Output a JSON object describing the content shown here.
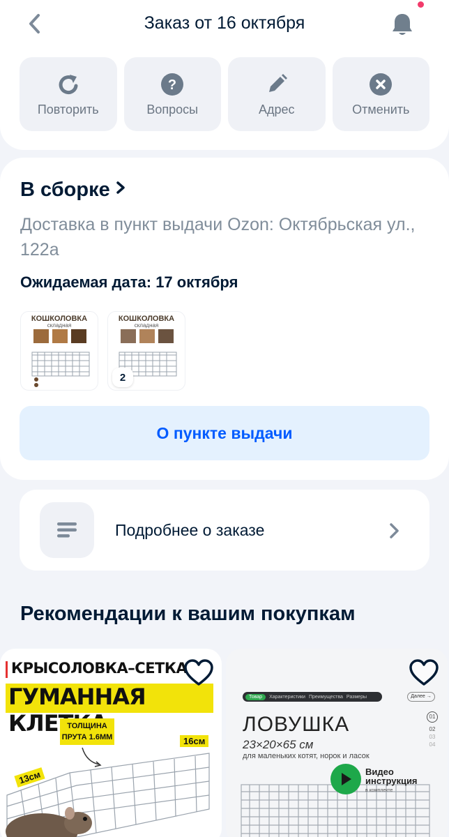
{
  "header": {
    "title": "Заказ от 16 октября",
    "back_icon": "chevron-left-icon",
    "bell_icon": "bell-icon"
  },
  "actions": [
    {
      "label": "Повторить",
      "icon": "repeat-icon"
    },
    {
      "label": "Вопросы",
      "icon": "question-icon"
    },
    {
      "label": "Адрес",
      "icon": "pencil-icon"
    },
    {
      "label": "Отменить",
      "icon": "close-circle-icon"
    }
  ],
  "status": {
    "title": "В сборке",
    "delivery": "Доставка в пункт выдачи Ozon: Октябрьская ул., 122а",
    "expected": "Ожидаемая дата: 17 октября"
  },
  "thumbnails": [
    {
      "name": "КОШКОЛОВКА",
      "sub": "складная"
    },
    {
      "name": "КОШКОЛОВКА",
      "sub": "складная",
      "count": "2"
    }
  ],
  "pickup_button": "О пункте выдачи",
  "more": {
    "label": "Подробнее о заказе"
  },
  "recommendations": {
    "title": "Рекомендации к вашим покупкам",
    "items": [
      {
        "line1": "КРЫСОЛОВКА–СЕТКА",
        "line2": "ГУМАННАЯ КЛЕТКА",
        "tag": "ТОЛЩИНА ПРУТА 1.6ММ",
        "dim_a": "16см",
        "dim_b": "13см"
      },
      {
        "nav": [
          "Товар",
          "Характеристики",
          "Преимущества",
          "Размеры"
        ],
        "next": "Далее →",
        "title": "ЛОВУШКА",
        "size": "23×20×65 см",
        "desc": "для маленьких котят, норок и ласок",
        "pages": [
          "01",
          "02",
          "03",
          "04"
        ],
        "video_title": "Видео инструкция",
        "video_sub": "в комплекте"
      }
    ]
  },
  "colors": {
    "accent": "#005bff",
    "background": "#f2f4f9",
    "badge_dot": "#f23b6b",
    "highlight_yellow": "#f2e30a",
    "play_green": "#1ea84a"
  }
}
